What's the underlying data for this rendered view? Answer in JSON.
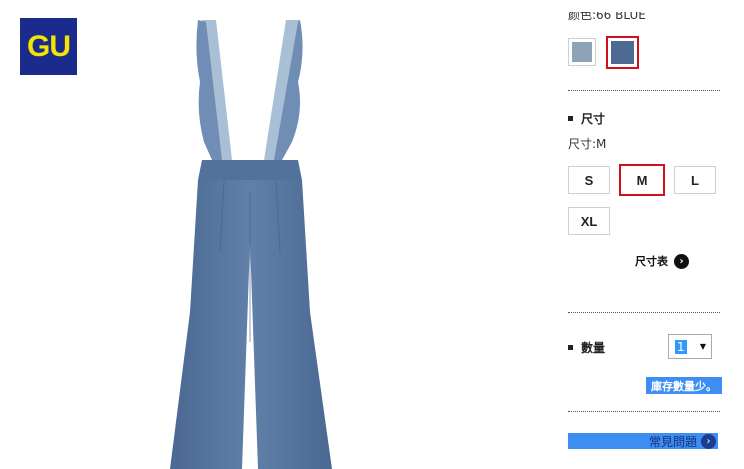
{
  "brand": {
    "logo_text": "GU",
    "logo_bg": "#1a2b8c",
    "logo_fg": "#f2e600"
  },
  "product_image": {
    "description_icon": "overall-pants-image",
    "fabric_color": "#5877a3"
  },
  "color": {
    "label": "颜色:66 BLUE",
    "swatches": [
      {
        "name": "light-blue",
        "hex": "#8ea3b5",
        "selected": false
      },
      {
        "name": "blue",
        "hex": "#4d6a92",
        "selected": true
      }
    ]
  },
  "size": {
    "heading": "尺寸",
    "current": "尺寸:M",
    "options": [
      "S",
      "M",
      "L",
      "XL"
    ],
    "selected": "M",
    "chart_link": "尺寸表"
  },
  "quantity": {
    "heading": "數量",
    "value": "1"
  },
  "stock_note": "庫存數量少。",
  "faq_link": "常見問題",
  "accent": "#d0101e",
  "highlight": "#3d8ef0"
}
